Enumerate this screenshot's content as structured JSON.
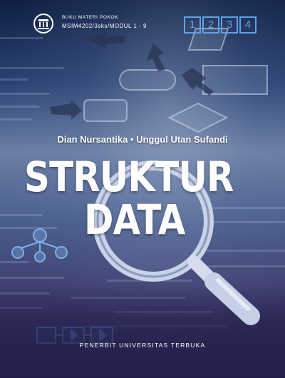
{
  "header": {
    "series_label": "BUKU MATERI POKOK",
    "course_code": "MSIM4202/3sks/MODUL 1 - 9"
  },
  "modules": [
    "1",
    "2",
    "3",
    "4"
  ],
  "authors": "Dian Nursantika • Unggul Utan Sufandi",
  "title": {
    "line1": "STRUKTUR",
    "line2": "DATA"
  },
  "publisher": "PENERBIT UNIVERSITAS TERBUKA",
  "colors": {
    "module_box": "#5fa2e8",
    "title": "#ffffff"
  }
}
